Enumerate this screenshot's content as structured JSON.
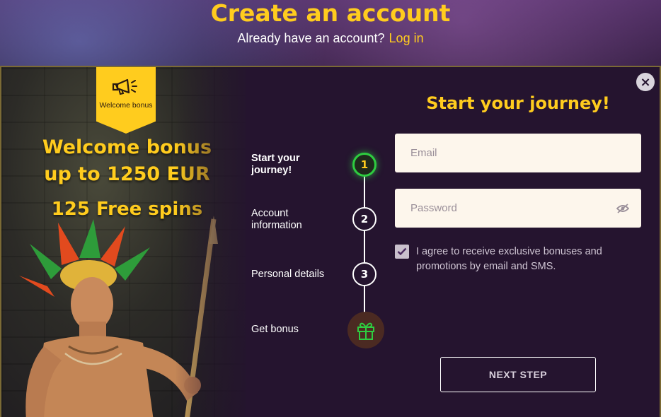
{
  "page": {
    "title": "Create an account",
    "login_prompt": "Already have an account?",
    "login_link": "Log in"
  },
  "promo": {
    "ribbon_label": "Welcome bonus",
    "ribbon_icon": "megaphone-icon",
    "headline_1": "Welcome bonus",
    "headline_2": "up to 1250 EUR",
    "headline_3": "125 Free spins"
  },
  "steps": [
    {
      "label": "Start your journey!",
      "number": "1",
      "active": true
    },
    {
      "label": "Account information",
      "number": "2",
      "active": false
    },
    {
      "label": "Personal details",
      "number": "3",
      "active": false
    },
    {
      "label": "Get bonus",
      "icon": "gift-icon",
      "active": false
    }
  ],
  "form": {
    "title": "Start your journey!",
    "email_placeholder": "Email",
    "password_placeholder": "Password",
    "agree_checked": true,
    "agree_text": "I agree to receive exclusive bonuses and promotions by email and SMS.",
    "next_label": "NEXT STEP"
  },
  "colors": {
    "accent": "#ffcc1e",
    "background": "#25142f",
    "active_step": "#2ecc40"
  }
}
